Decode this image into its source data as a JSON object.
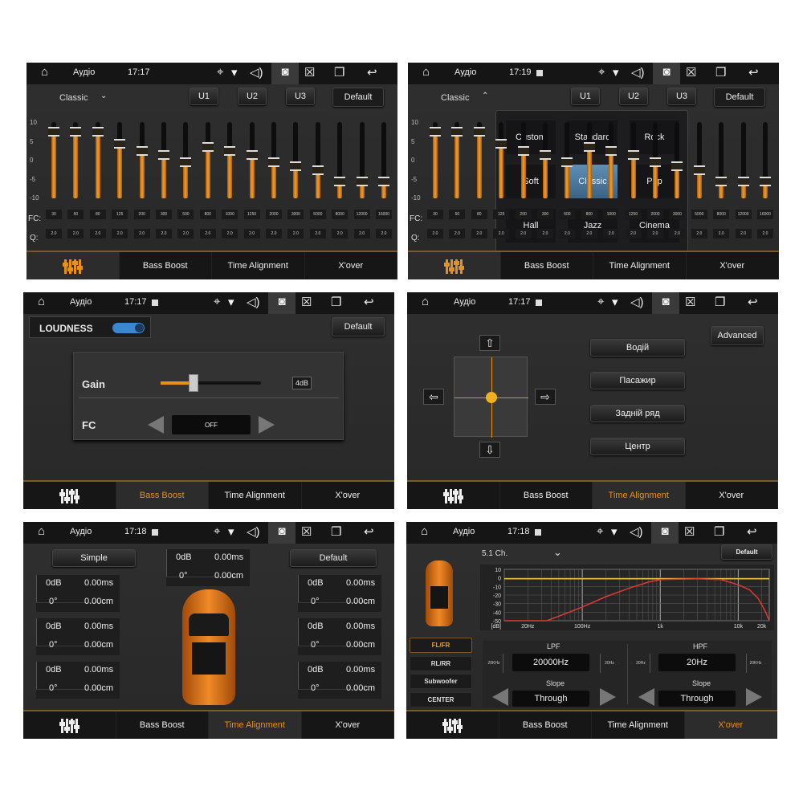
{
  "status_icons": {
    "home": "home-icon",
    "location": "location-icon",
    "wifi": "wifi-icon",
    "volume": "volume-icon",
    "screenshot": "camera-icon",
    "close": "close-box-icon",
    "recents": "recent-apps-icon",
    "back": "back-icon"
  },
  "tabs": {
    "eq_icon": "equalizer-icon",
    "items": [
      "Bass Boost",
      "Time Alignment",
      "X'over"
    ]
  },
  "colors": {
    "accent": "#e8901a",
    "slider_fill": "#f2a030",
    "popup_selected": "#4f7aa0",
    "curve": "#e03a30",
    "flat_line": "#e8c040"
  },
  "panels": [
    {
      "title": "Аудіо",
      "time": "17:17",
      "active_tab": 0
    },
    {
      "title": "Аудіо",
      "time": "17:19",
      "active_tab": 0
    },
    {
      "title": "Аудіо",
      "time": "17:17",
      "active_tab": 1
    },
    {
      "title": "Аудіо",
      "time": "17:17",
      "active_tab": 2
    },
    {
      "title": "Аудіо",
      "time": "17:18",
      "active_tab": 2
    },
    {
      "title": "Аудіо",
      "time": "17:18",
      "active_tab": 3
    }
  ],
  "eq": {
    "preset": "Classic",
    "user_buttons": [
      "U1",
      "U2",
      "U3"
    ],
    "default_label": "Default",
    "y_ticks": [
      "10",
      "5",
      "0",
      "-5",
      "-10"
    ],
    "fc_label": "FC:",
    "q_label": "Q:",
    "fc": [
      "30",
      "50",
      "80",
      "125",
      "200",
      "300",
      "500",
      "800",
      "1000",
      "1250",
      "2000",
      "3000",
      "5000",
      "8000",
      "12000",
      "16000"
    ],
    "q": [
      "2.0",
      "2.0",
      "2.0",
      "2.0",
      "2.0",
      "2.0",
      "2.0",
      "2.0",
      "2.0",
      "2.0",
      "2.0",
      "2.0",
      "2.0",
      "2.0",
      "2.0",
      "2.0"
    ],
    "gains_db": [
      7,
      7,
      7,
      4,
      2,
      1,
      -1,
      3,
      2,
      1,
      -1,
      -2,
      -3,
      -6,
      -6,
      -6
    ]
  },
  "preset_popup": {
    "options": [
      "Custom",
      "Standard",
      "Rock",
      "Soft",
      "Classic",
      "Pop",
      "Hall",
      "Jazz",
      "Cinema"
    ],
    "selected": "Classic"
  },
  "bass_boost": {
    "loudness_label": "LOUDNESS",
    "loudness_on": true,
    "default_label": "Default",
    "gain_label": "Gain",
    "gain_value": "4dB",
    "gain_fraction": 0.33,
    "fc_label": "FC",
    "fc_value": "OFF"
  },
  "seat": {
    "advanced_label": "Advanced",
    "buttons": [
      "Водій",
      "Пасажир",
      "Задній ряд",
      "Центр"
    ],
    "arrows": {
      "up": "⇧",
      "down": "⇩",
      "left": "⇦",
      "right": "⇨"
    }
  },
  "time_alignment": {
    "simple_label": "Simple",
    "default_label": "Default",
    "channels": [
      {
        "db": "0dB",
        "ms": "0.00ms",
        "deg": "0°",
        "cm": "0.00cm"
      },
      {
        "db": "0dB",
        "ms": "0.00ms",
        "deg": "0°",
        "cm": "0.00cm"
      },
      {
        "db": "0dB",
        "ms": "0.00ms",
        "deg": "0°",
        "cm": "0.00cm"
      },
      {
        "db": "0dB",
        "ms": "0.00ms",
        "deg": "0°",
        "cm": "0.00cm"
      },
      {
        "db": "0dB",
        "ms": "0.00ms",
        "deg": "0°",
        "cm": "0.00cm"
      },
      {
        "db": "0dB",
        "ms": "0.00ms",
        "deg": "0°",
        "cm": "0.00cm"
      },
      {
        "db": "0dB",
        "ms": "0.00ms",
        "deg": "0°",
        "cm": "0.00cm"
      }
    ]
  },
  "xover": {
    "mode": "5.1 Ch.",
    "default_label": "Default",
    "channels": [
      "FL/FR",
      "RL/RR",
      "Subwoofer",
      "CENTER"
    ],
    "selected_channel": "FL/FR",
    "lpf": {
      "label": "LPF",
      "value": "20000Hz",
      "left": "20KHz",
      "right": "20Hz",
      "slope_label": "Slope",
      "slope": "Through"
    },
    "hpf": {
      "label": "HPF",
      "value": "20Hz",
      "left": "20Hz",
      "right": "20KHz",
      "slope_label": "Slope",
      "slope": "Through"
    }
  },
  "chart_data": {
    "type": "line",
    "xscale": "log",
    "xlim": [
      10,
      25000
    ],
    "ylim": [
      -50,
      10
    ],
    "x_ticks": [
      "20Hz",
      "100Hz",
      "1k",
      "10k",
      "20k"
    ],
    "y_ticks": [
      "10",
      "0",
      "-10",
      "-20",
      "-30",
      "-40",
      "-50"
    ],
    "ylabel": "[dB]",
    "grid": true,
    "series": [
      {
        "color": "#e8c040",
        "x": [
          10,
          25000
        ],
        "y": [
          -1,
          -1
        ]
      },
      {
        "color": "#e03a30",
        "x": [
          10,
          35,
          60,
          100,
          200,
          400,
          700,
          1000,
          3000,
          6000,
          10000,
          14000,
          18000,
          22000,
          25000
        ],
        "y": [
          -50,
          -50,
          -42,
          -34,
          -22,
          -12,
          -5,
          -2,
          -1,
          -2,
          -8,
          -14,
          -24,
          -38,
          -50
        ]
      }
    ]
  }
}
